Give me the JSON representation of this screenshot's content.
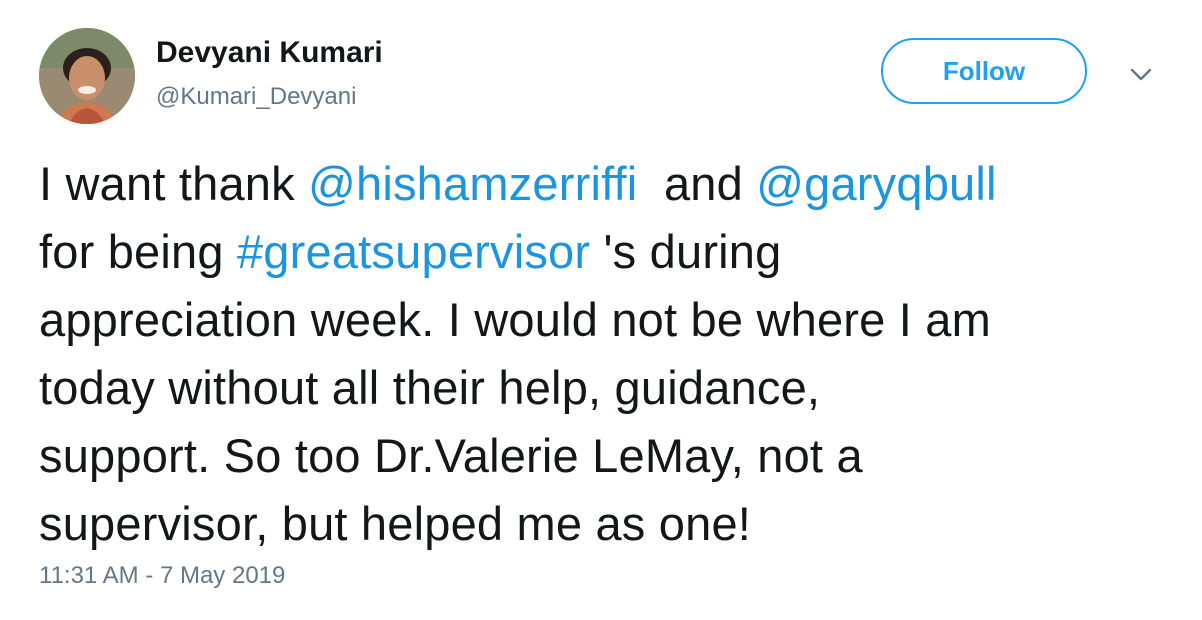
{
  "user": {
    "display_name": "Devyani Kumari",
    "handle": "@Kumari_Devyani"
  },
  "actions": {
    "follow_label": "Follow",
    "more_icon": "chevron-down-icon"
  },
  "tweet": {
    "line1": {
      "t1": "I want thank ",
      "m1": "@hishamzerriffi",
      "t2": "  and ",
      "m2": "@garyqbull"
    },
    "line2": {
      "t1": "for being ",
      "h1": "#greatsupervisor",
      "t2": " 's during"
    },
    "line3": "appreciation week. I would not be where I am",
    "line4": "today without all their help, guidance,",
    "line5": "support. So too Dr.Valerie LeMay, not a",
    "line6": "supervisor, but helped me as one!"
  },
  "timestamp": "11:31 AM - 7 May 2019",
  "colors": {
    "link": "#1b95e0",
    "follow_accent": "#1da1f2",
    "text": "#14171a",
    "secondary": "#657786"
  }
}
